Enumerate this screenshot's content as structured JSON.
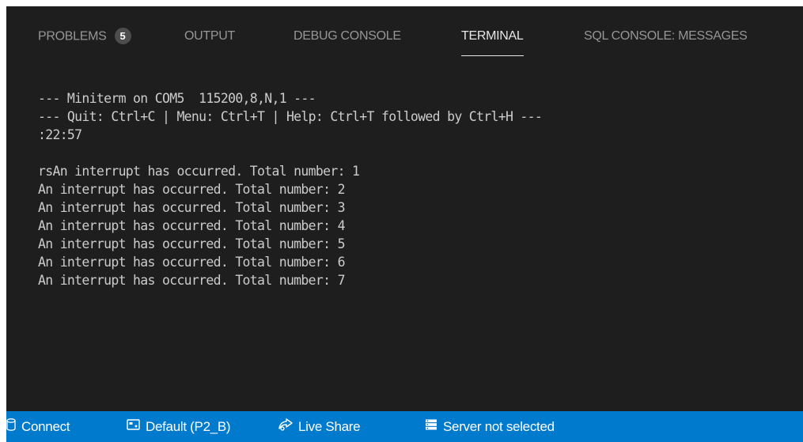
{
  "panel": {
    "tabs": [
      {
        "label": "PROBLEMS",
        "badge": "5",
        "active": false
      },
      {
        "label": "OUTPUT",
        "active": false
      },
      {
        "label": "DEBUG CONSOLE",
        "active": false
      },
      {
        "label": "TERMINAL",
        "active": true
      },
      {
        "label": "SQL CONSOLE: MESSAGES",
        "active": false
      }
    ]
  },
  "terminal": {
    "lines": [
      "--- Miniterm on COM5  115200,8,N,1 ---",
      "--- Quit: Ctrl+C | Menu: Ctrl+T | Help: Ctrl+T followed by Ctrl+H ---",
      ":22:57",
      "",
      "rsAn interrupt has occurred. Total number: 1",
      "An interrupt has occurred. Total number: 2",
      "An interrupt has occurred. Total number: 3",
      "An interrupt has occurred. Total number: 4",
      "An interrupt has occurred. Total number: 5",
      "An interrupt has occurred. Total number: 6",
      "An interrupt has occurred. Total number: 7"
    ]
  },
  "statusbar": {
    "background": "#007acc",
    "items": [
      {
        "icon": "database-icon",
        "label": "Connect"
      },
      {
        "icon": "board-icon",
        "label": "Default (P2_B)"
      },
      {
        "icon": "live-share-icon",
        "label": "Live Share"
      },
      {
        "icon": "server-icon",
        "label": "Server not selected"
      }
    ]
  }
}
